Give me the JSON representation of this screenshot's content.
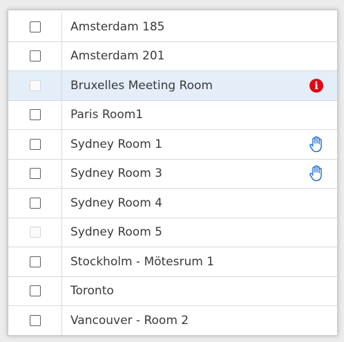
{
  "rooms": [
    {
      "name": "Amsterdam 185",
      "checkbox": "enabled",
      "selected": false,
      "status_icon": ""
    },
    {
      "name": "Amsterdam 201",
      "checkbox": "enabled",
      "selected": false,
      "status_icon": ""
    },
    {
      "name": "Bruxelles Meeting Room",
      "checkbox": "disabled",
      "selected": true,
      "status_icon": "info-icon"
    },
    {
      "name": "Paris Room1",
      "checkbox": "enabled",
      "selected": false,
      "status_icon": ""
    },
    {
      "name": "Sydney Room 1",
      "checkbox": "enabled",
      "selected": false,
      "status_icon": "hand-icon"
    },
    {
      "name": "Sydney Room 3",
      "checkbox": "enabled",
      "selected": false,
      "status_icon": "hand-icon"
    },
    {
      "name": "Sydney Room 4",
      "checkbox": "enabled",
      "selected": false,
      "status_icon": ""
    },
    {
      "name": "Sydney Room 5",
      "checkbox": "disabled",
      "selected": false,
      "status_icon": ""
    },
    {
      "name": "Stockholm - Mötesrum 1",
      "checkbox": "enabled",
      "selected": false,
      "status_icon": ""
    },
    {
      "name": "Toronto",
      "checkbox": "enabled",
      "selected": false,
      "status_icon": ""
    },
    {
      "name": "Vancouver - Room 2",
      "checkbox": "enabled",
      "selected": false,
      "status_icon": ""
    }
  ],
  "icons": {
    "info_glyph": "i",
    "info_color": "#e30613",
    "hand_color": "#1e6fd1"
  },
  "colors": {
    "selected_row": "#e3eef8",
    "text": "#3a3a3a",
    "border": "#d9d9d9"
  }
}
